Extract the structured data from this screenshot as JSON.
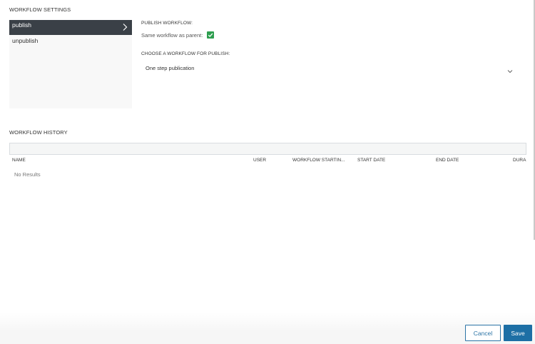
{
  "settings": {
    "title": "WORKFLOW SETTINGS",
    "items": [
      {
        "label": "publish",
        "active": true
      },
      {
        "label": "unpublish",
        "active": false
      }
    ],
    "publish_workflow_label": "PUBLISH WORKFLOW:",
    "same_as_parent_label": "Same workflow as parent:",
    "same_as_parent_checked": true,
    "choose_workflow_label": "CHOOSE A WORKFLOW FOR PUBLISH:",
    "selected_workflow": "One step publication"
  },
  "history": {
    "title": "WORKFLOW HISTORY",
    "columns": [
      "NAME",
      "USER",
      "WORKFLOW STARTIN...",
      "START DATE",
      "END DATE",
      "DURA"
    ],
    "empty_text": "No Results"
  },
  "footer": {
    "cancel_label": "Cancel",
    "save_label": "Save"
  },
  "colors": {
    "active_item_bg": "#3a4047",
    "checkbox": "#2e9e4f",
    "primary": "#1d6fa5"
  },
  "icons": {
    "active_item_icon": "chevron-right-icon",
    "select_icon": "chevron-down-icon",
    "checkbox_icon": "check-icon"
  }
}
